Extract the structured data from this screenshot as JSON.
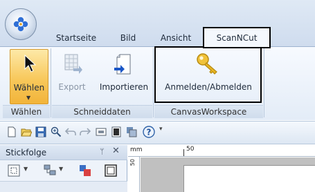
{
  "tabs": {
    "startseite": "Startseite",
    "bild": "Bild",
    "ansicht": "Ansicht",
    "scanncut": "ScanNCut"
  },
  "ribbon": {
    "waehlen_label": "Wählen",
    "export_label": "Export",
    "importieren_label": "Importieren",
    "anmelden_label": "Anmelden/Abmelden",
    "groups": {
      "waehlen": "Wählen",
      "schneiddaten": "Schneiddaten",
      "canvasworkspace": "CanvasWorkspace"
    }
  },
  "panel": {
    "title": "Stickfolge"
  },
  "ruler": {
    "unit": "mm",
    "mark_50": "50",
    "left_mark": "50"
  },
  "colors": {
    "accent_key": "#e6b422",
    "selected_button": "#f8c85b"
  }
}
